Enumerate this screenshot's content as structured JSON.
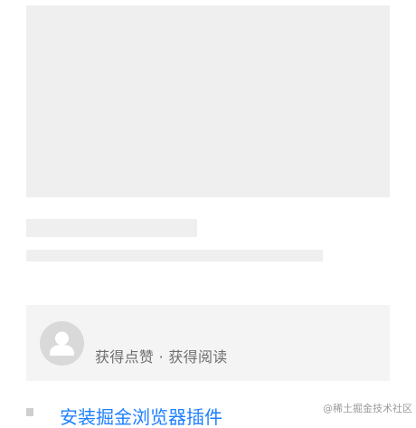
{
  "promo": {
    "text": "获得点赞 · 获得阅读"
  },
  "link": {
    "text": "安装掘金浏览器插件"
  },
  "watermark": {
    "text": "@稀土掘金技术社区"
  },
  "colors": {
    "skeleton": "#efefef",
    "card_bg": "#f4f4f4",
    "link": "#1e80ff"
  },
  "icons": {
    "avatar": "user-avatar-placeholder-icon"
  }
}
